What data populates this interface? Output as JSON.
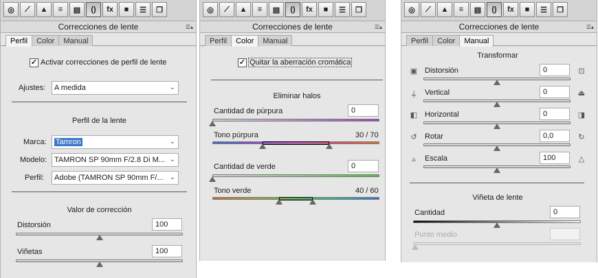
{
  "toolbar": {
    "icons": [
      "camera-aperture-icon",
      "tone-curve-icon",
      "detail-icon",
      "hsl-icon",
      "split-toning-icon",
      "lens-corrections-icon",
      "fx-icon",
      "camera-calibration-icon",
      "presets-icon",
      "snapshots-icon"
    ],
    "fx_label": "fx"
  },
  "panel1": {
    "header": "Correcciones de lente",
    "tabs": [
      "Perfil",
      "Color",
      "Manual"
    ],
    "enable_label": "Activar correcciones de perfil de lente",
    "ajustes_label": "Ajustes:",
    "ajustes_value": "A medida",
    "profile_title": "Perfil de la lente",
    "marca_label": "Marca:",
    "marca_value": "Tamron",
    "modelo_label": "Modelo:",
    "modelo_value": "TAMRON SP 90mm F/2.8 Di M...",
    "perfil_label": "Perfil:",
    "perfil_value": "Adobe (TAMRON SP 90mm F/...",
    "correction_title": "Valor de corrección",
    "distorsion_label": "Distorsión",
    "distorsion_value": "100",
    "distorsion_level": 0.5,
    "vinetas_label": "Viñetas",
    "vinetas_value": "100",
    "vinetas_level": 0.5
  },
  "panel2": {
    "header": "Correcciones de lente",
    "tabs": [
      "Perfil",
      "Color",
      "Manual"
    ],
    "remove_ca_label": "Quitar la aberración cromática",
    "defringe_title": "Eliminar halos",
    "purple_amount_label": "Cantidad de púrpura",
    "purple_amount_value": "0",
    "purple_hue_label": "Tono púrpura",
    "purple_hue_value": "30 / 70",
    "purple_hue_range": [
      30,
      70
    ],
    "green_amount_label": "Cantidad de verde",
    "green_amount_value": "0",
    "green_hue_label": "Tono verde",
    "green_hue_value": "40 / 60",
    "green_hue_range": [
      40,
      60
    ],
    "colors": {
      "purple": "#a040c0",
      "green": "#50c040"
    }
  },
  "panel3": {
    "header": "Correcciones de lente",
    "tabs": [
      "Perfil",
      "Color",
      "Manual"
    ],
    "transform_title": "Transformar",
    "distorsion_label": "Distorsión",
    "distorsion_value": "0",
    "vertical_label": "Vertical",
    "vertical_value": "0",
    "horizontal_label": "Horizontal",
    "horizontal_value": "0",
    "rotar_label": "Rotar",
    "rotar_value": "0,0",
    "escala_label": "Escala",
    "escala_value": "100",
    "vignette_title": "Viñeta de lente",
    "cantidad_label": "Cantidad",
    "cantidad_value": "0",
    "punto_medio_label": "Punto medio",
    "punto_medio_value": ""
  }
}
